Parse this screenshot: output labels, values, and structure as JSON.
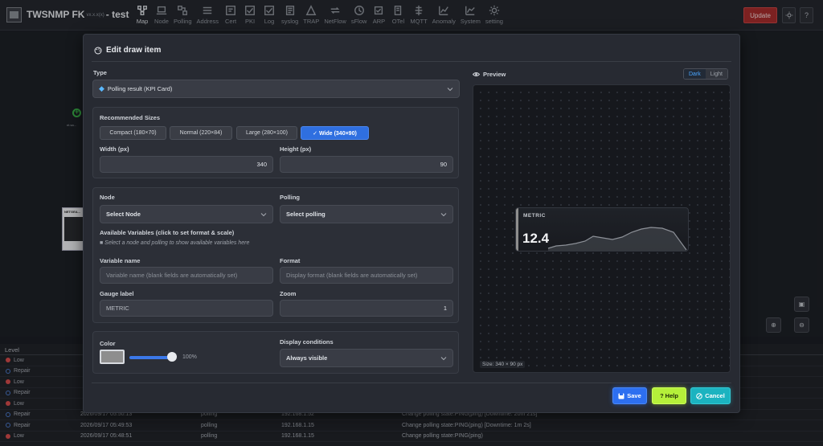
{
  "app": {
    "title": "TWSNMP FK",
    "version": "vx.x.x(x)",
    "map_name": "- test"
  },
  "nav": [
    {
      "label": "Map",
      "icon": "map-icon"
    },
    {
      "label": "Node",
      "icon": "laptop-icon"
    },
    {
      "label": "Polling",
      "icon": "polling-icon"
    },
    {
      "label": "Address",
      "icon": "address-icon"
    },
    {
      "label": "Cert",
      "icon": "cert-icon"
    },
    {
      "label": "PKI",
      "icon": "pki-icon"
    },
    {
      "label": "Log",
      "icon": "log-icon"
    },
    {
      "label": "syslog",
      "icon": "syslog-icon"
    },
    {
      "label": "TRAP",
      "icon": "trap-icon"
    },
    {
      "label": "NetFlow",
      "icon": "netflow-icon"
    },
    {
      "label": "sFlow",
      "icon": "sflow-icon"
    },
    {
      "label": "ARP",
      "icon": "arp-icon"
    },
    {
      "label": "OTel",
      "icon": "otel-icon"
    },
    {
      "label": "MQTT",
      "icon": "mqtt-icon"
    },
    {
      "label": "Anomaly",
      "icon": "anomaly-icon"
    },
    {
      "label": "System",
      "icon": "system-icon"
    },
    {
      "label": "setting",
      "icon": "gear-icon"
    }
  ],
  "header": {
    "update_label": "Update",
    "theme_icon": "sun-icon",
    "help_icon": "question-icon",
    "help_glyph": "?"
  },
  "map": {
    "node1_label": "nt.sa...",
    "node2_label": "NETGEA..."
  },
  "log": {
    "header_level": "Level",
    "rows": [
      {
        "level": "Low",
        "status": "red",
        "time": "",
        "type": "",
        "ip": "",
        "msg": ""
      },
      {
        "level": "Repair",
        "status": "blue",
        "time": "",
        "type": "",
        "ip": "",
        "msg": ""
      },
      {
        "level": "Low",
        "status": "red",
        "time": "",
        "type": "",
        "ip": "",
        "msg": ""
      },
      {
        "level": "Repair",
        "status": "blue",
        "time": "",
        "type": "",
        "ip": "",
        "msg": ""
      },
      {
        "level": "Low",
        "status": "red",
        "time": "",
        "type": "",
        "ip": "",
        "msg": ""
      },
      {
        "level": "Repair",
        "status": "blue",
        "time": "2026/09/17 05:50:13",
        "type": "polling",
        "ip": "192.168.1.52",
        "msg": "Change polling state:PING(ping) [Downtime: 20m 21s]"
      },
      {
        "level": "Repair",
        "status": "blue",
        "time": "2026/09/17 05:49:53",
        "type": "polling",
        "ip": "192.168.1.15",
        "msg": "Change polling state:PING(ping) [Downtime: 1m 2s]"
      },
      {
        "level": "Low",
        "status": "red",
        "time": "2026/09/17 05:48:51",
        "type": "polling",
        "ip": "192.168.1.15",
        "msg": "Change polling state:PING(ping)"
      }
    ]
  },
  "modal": {
    "title": "Edit draw item",
    "type_label": "Type",
    "type_value": "Polling result (KPI Card)",
    "recommended_label": "Recommended Sizes",
    "sizes": [
      "Compact (180×70)",
      "Normal (220×84)",
      "Large (280×100)",
      "✓ Wide (340×90)"
    ],
    "width_label": "Width (px)",
    "width_value": "340",
    "height_label": "Height (px)",
    "height_value": "90",
    "node_label": "Node",
    "node_value": "Select Node",
    "polling_label": "Polling",
    "polling_value": "Select polling",
    "avail_label": "Available Variables (click to set format & scale)",
    "avail_hint": "■ Select a node and polling to show available variables here",
    "varname_label": "Variable name",
    "varname_placeholder": "Variable name (blank fields are automatically set)",
    "format_label": "Format",
    "format_placeholder": "Display format (blank fields are automatically set)",
    "gauge_label": "Gauge label",
    "gauge_value": "METRIC",
    "zoom_label": "Zoom",
    "zoom_value": "1",
    "color_label": "Color",
    "color_value": "#8e8e8e",
    "opacity_text": "100%",
    "opacity_value": 100,
    "cond_label": "Display conditions",
    "cond_value": "Always visible",
    "preview_label": "Preview",
    "theme_dark": "Dark",
    "theme_light": "Light",
    "kpi_label": "METRIC",
    "kpi_value": "12.4",
    "size_text": "Size: 340 × 90 px",
    "save_label": "Save",
    "help_label": "Help",
    "cancel_label": "Cancel"
  }
}
